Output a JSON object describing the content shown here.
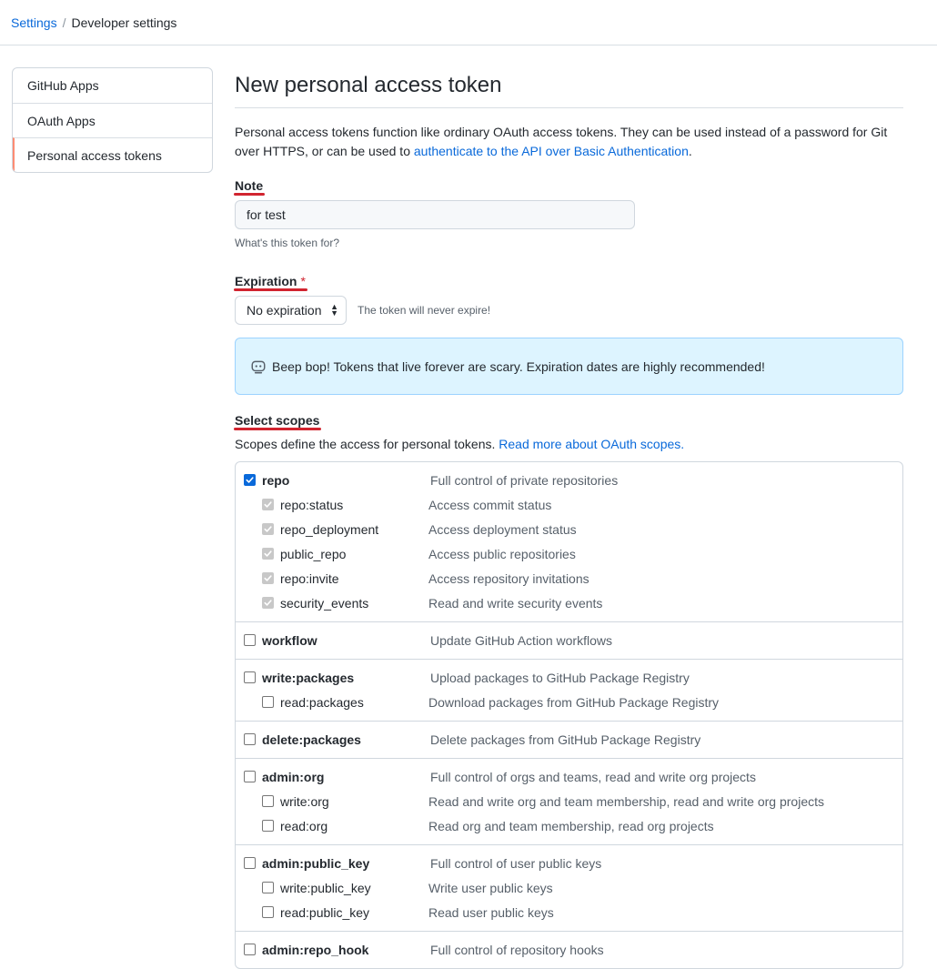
{
  "breadcrumb": {
    "settings": "Settings",
    "separator": "/",
    "current": "Developer settings"
  },
  "sidebar": {
    "items": [
      {
        "label": "GitHub Apps",
        "selected": false
      },
      {
        "label": "OAuth Apps",
        "selected": false
      },
      {
        "label": "Personal access tokens",
        "selected": true
      }
    ]
  },
  "main": {
    "title": "New personal access token",
    "intro_text": "Personal access tokens function like ordinary OAuth access tokens. They can be used instead of a password for Git over HTTPS, or can be used to ",
    "intro_link": "authenticate to the API over Basic Authentication",
    "intro_end": ".",
    "note": {
      "label": "Note",
      "value": "for test",
      "hint": "What's this token for?"
    },
    "expiration": {
      "label": "Expiration",
      "required_mark": "*",
      "selected": "No expiration",
      "note": "The token will never expire!"
    },
    "flash": {
      "icon": "copilot-bot-icon",
      "text": "Beep bop! Tokens that live forever are scary. Expiration dates are highly recommended!"
    },
    "scopes": {
      "label": "Select scopes",
      "desc_text": "Scopes define the access for personal tokens. ",
      "desc_link": "Read more about OAuth scopes.",
      "groups": [
        {
          "name": "repo",
          "desc": "Full control of private repositories",
          "checked": true,
          "children": [
            {
              "name": "repo:status",
              "desc": "Access commit status"
            },
            {
              "name": "repo_deployment",
              "desc": "Access deployment status"
            },
            {
              "name": "public_repo",
              "desc": "Access public repositories"
            },
            {
              "name": "repo:invite",
              "desc": "Access repository invitations"
            },
            {
              "name": "security_events",
              "desc": "Read and write security events"
            }
          ]
        },
        {
          "name": "workflow",
          "desc": "Update GitHub Action workflows",
          "checked": false,
          "children": []
        },
        {
          "name": "write:packages",
          "desc": "Upload packages to GitHub Package Registry",
          "checked": false,
          "children": [
            {
              "name": "read:packages",
              "desc": "Download packages from GitHub Package Registry"
            }
          ]
        },
        {
          "name": "delete:packages",
          "desc": "Delete packages from GitHub Package Registry",
          "checked": false,
          "children": []
        },
        {
          "name": "admin:org",
          "desc": "Full control of orgs and teams, read and write org projects",
          "checked": false,
          "children": [
            {
              "name": "write:org",
              "desc": "Read and write org and team membership, read and write org projects"
            },
            {
              "name": "read:org",
              "desc": "Read org and team membership, read org projects"
            }
          ]
        },
        {
          "name": "admin:public_key",
          "desc": "Full control of user public keys",
          "checked": false,
          "children": [
            {
              "name": "write:public_key",
              "desc": "Write user public keys"
            },
            {
              "name": "read:public_key",
              "desc": "Read user public keys"
            }
          ]
        },
        {
          "name": "admin:repo_hook",
          "desc": "Full control of repository hooks",
          "checked": false,
          "children": []
        }
      ]
    }
  },
  "colors": {
    "accent": "#0969da",
    "annotation_underline": "#d1242f",
    "flash_bg": "#ddf4ff",
    "selected_marker": "#fd8c73"
  }
}
